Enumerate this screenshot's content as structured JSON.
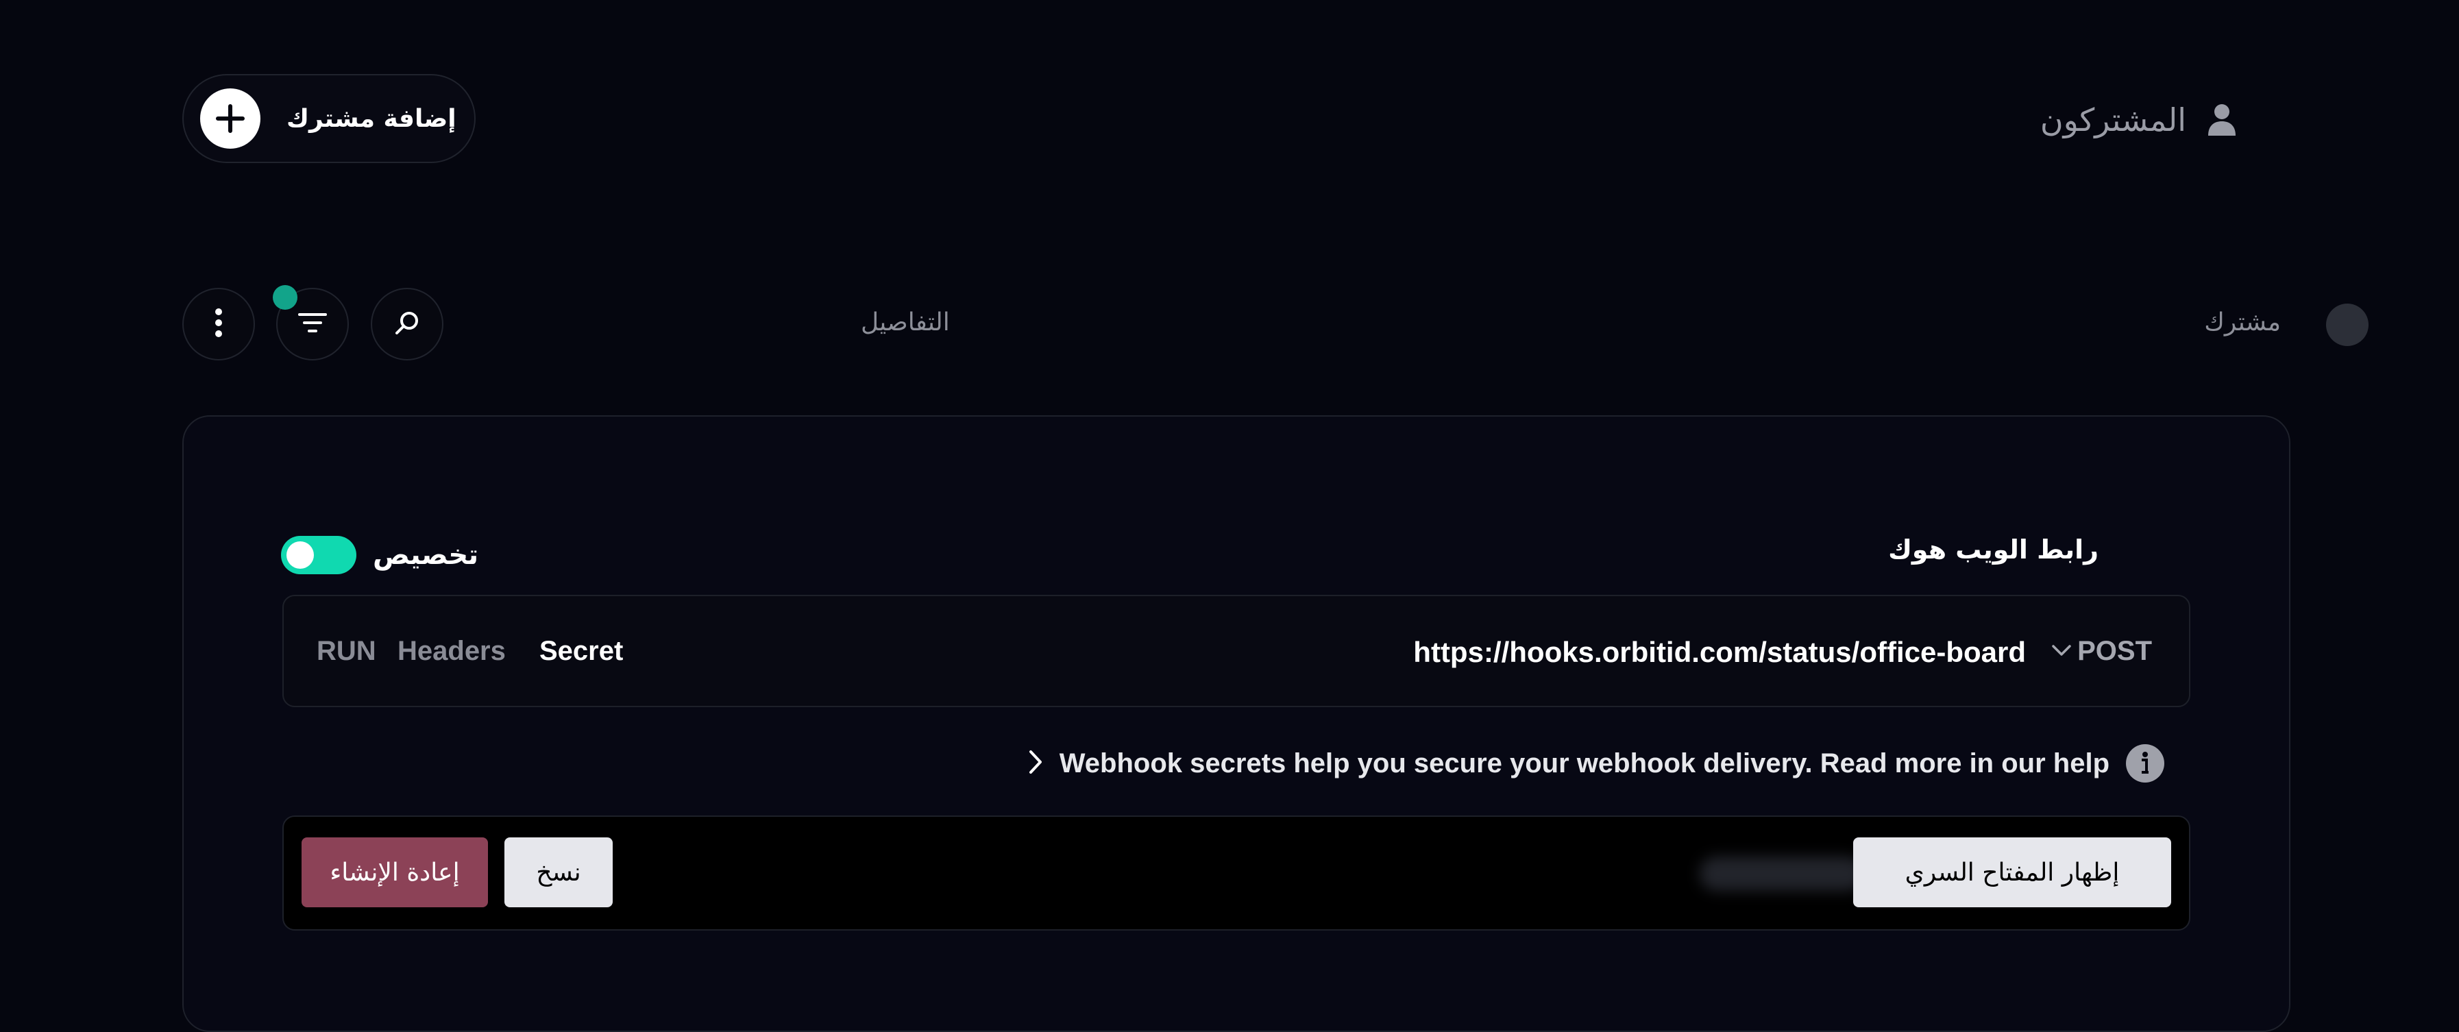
{
  "header": {
    "title": "المشتركون",
    "add_subscriber_label": "إضافة مشترك"
  },
  "list_header": {
    "details_col": "التفاصيل",
    "subscriber_col": "مشترك"
  },
  "webhook": {
    "section_title": "رابط الويب هوك",
    "customize_label": "تخصيص",
    "customize_on": true,
    "method": "POST",
    "url": "https://hooks.orbitid.com/status/office-board",
    "tabs": [
      "RUN",
      "Headers",
      "Secret"
    ],
    "active_tab": "Secret",
    "help_text": "Webhook secrets help you secure your webhook delivery. Read more in our help",
    "show_secret_label": "إظهار المفتاح السري",
    "copy_label": "نسخ",
    "regenerate_label": "إعادة الإنشاء"
  },
  "colors": {
    "background": "#05060f",
    "accent": "#10d9b0",
    "filter_badge": "#12a48a",
    "danger": "#8c4257"
  },
  "icons": [
    "user-icon",
    "plus-icon",
    "search-icon",
    "filter-icon",
    "more-vertical-icon",
    "chevron-down-icon",
    "chevron-right-icon",
    "info-icon"
  ]
}
